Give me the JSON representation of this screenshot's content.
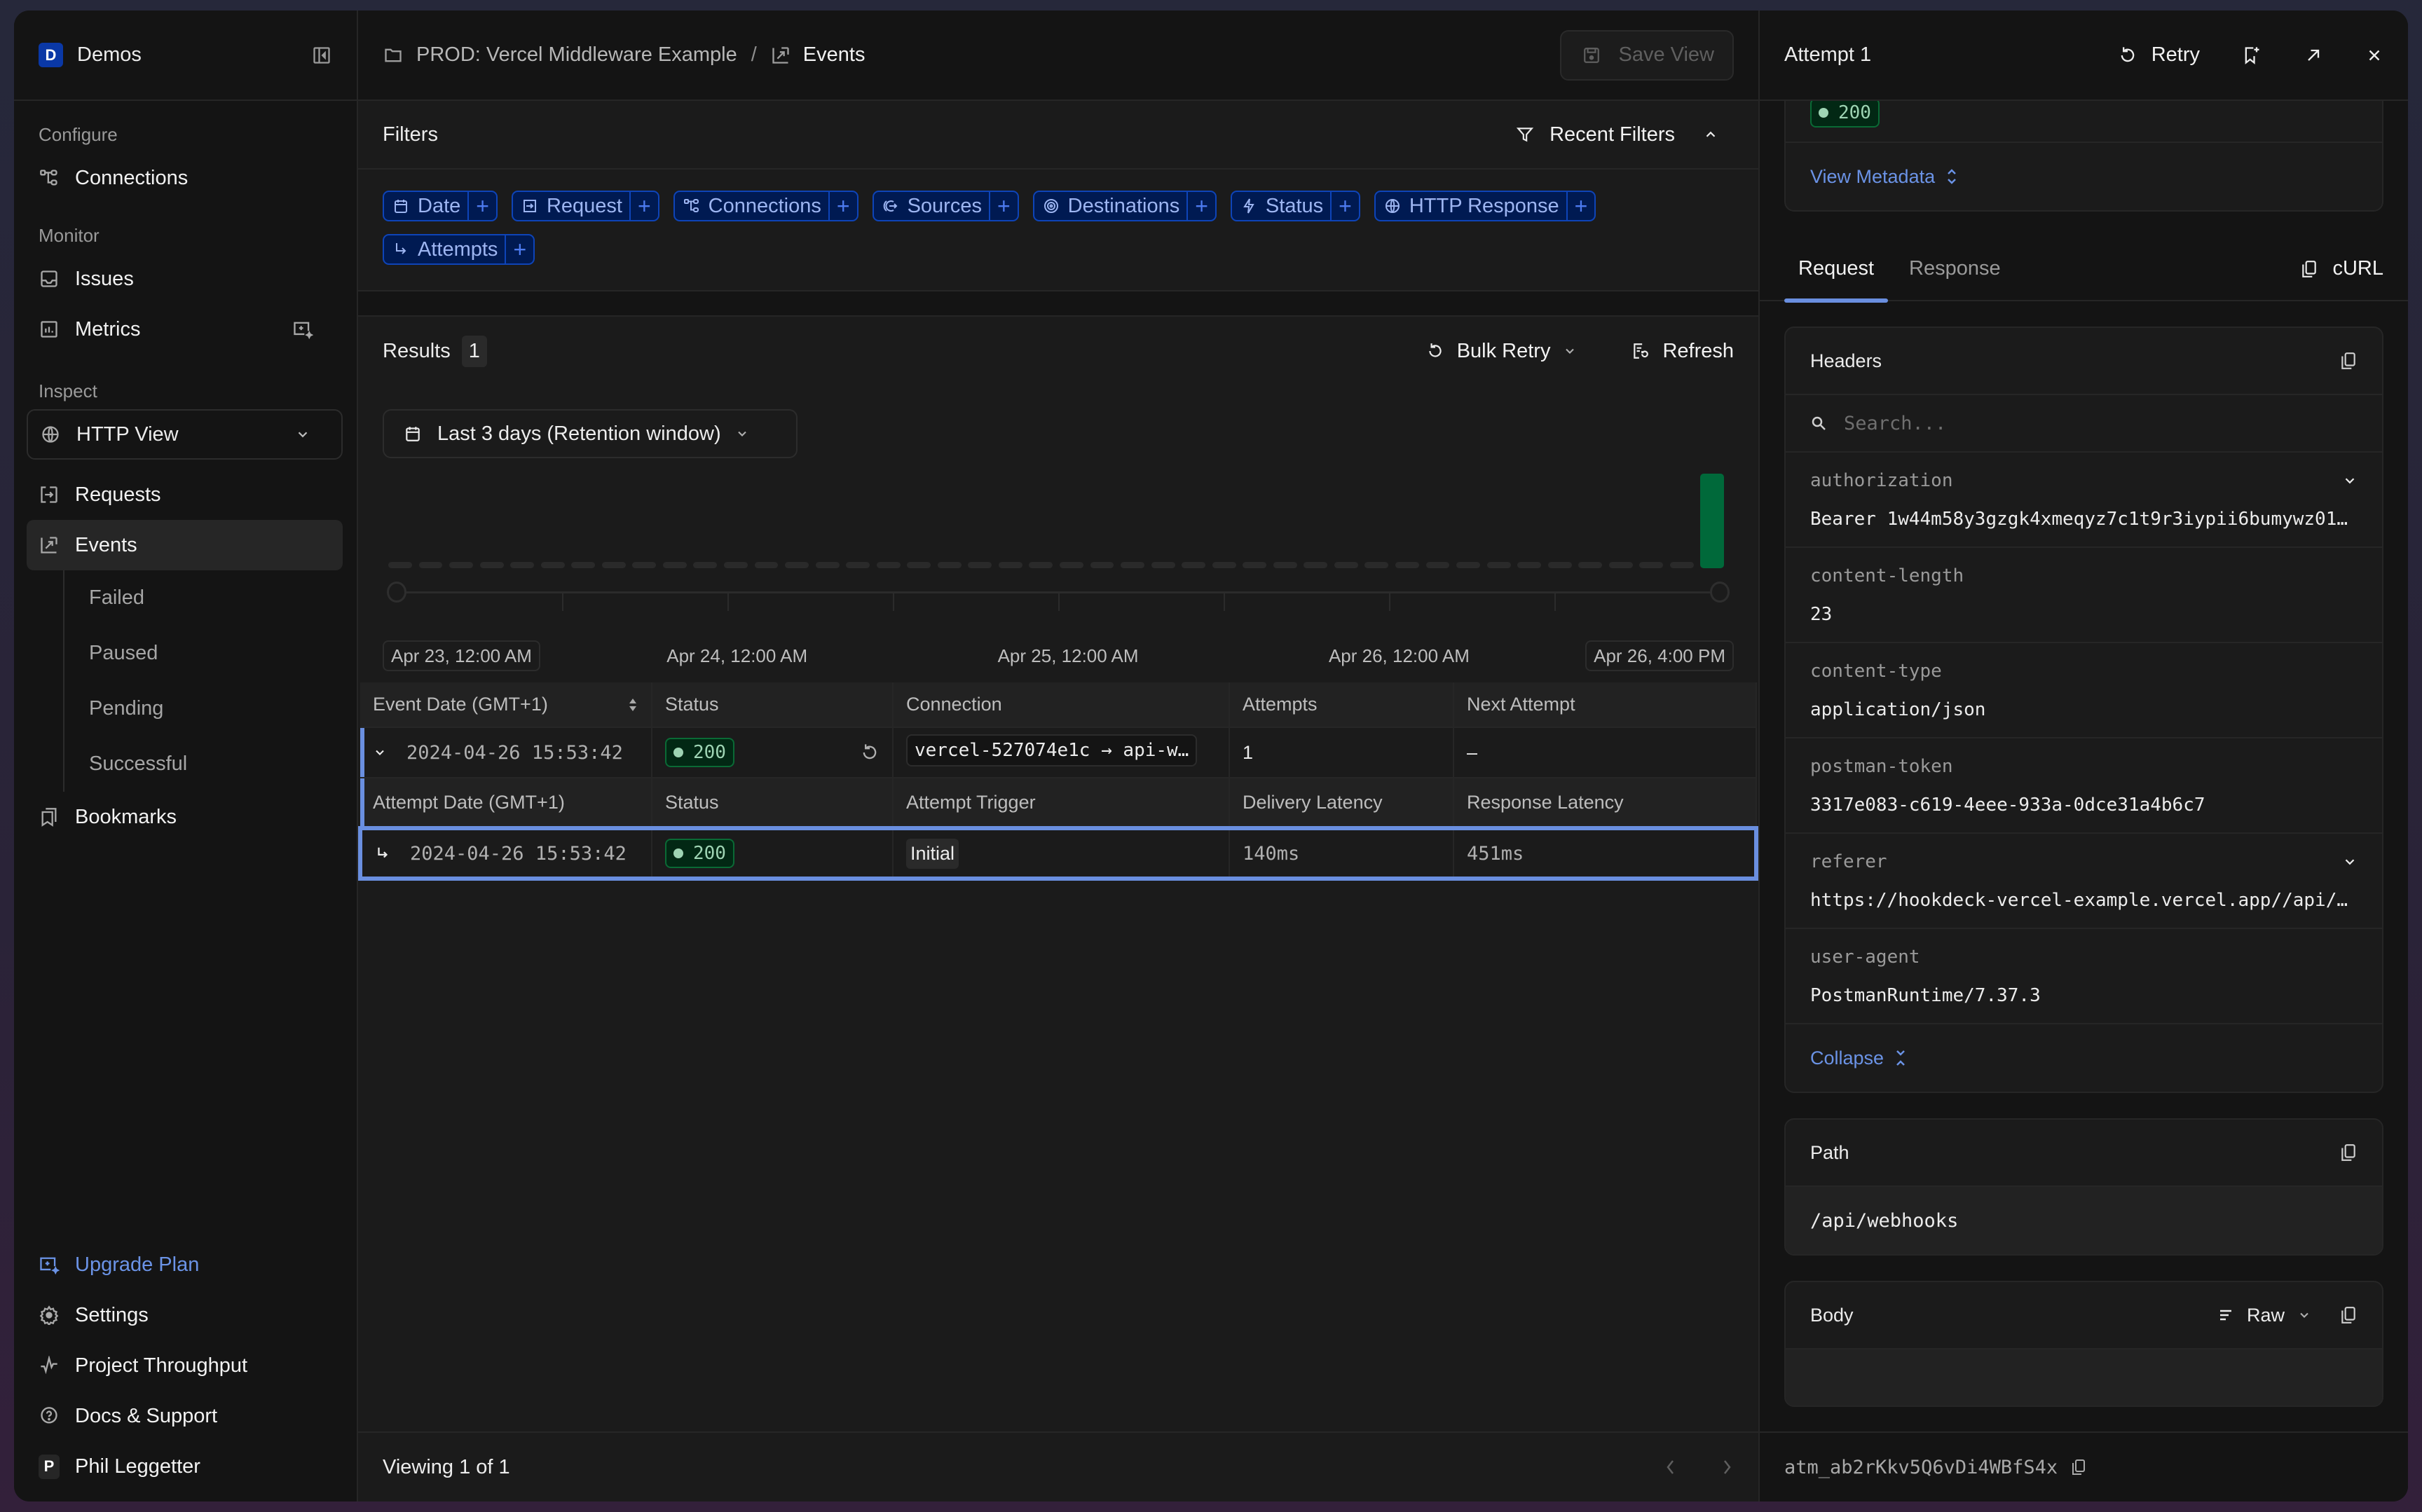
{
  "sidebar": {
    "workspace": {
      "initial": "D",
      "name": "Demos"
    },
    "sections": {
      "configure": "Configure",
      "monitor": "Monitor",
      "inspect": "Inspect"
    },
    "items": {
      "connections": "Connections",
      "issues": "Issues",
      "metrics": "Metrics",
      "view_select": "HTTP View",
      "requests": "Requests",
      "events": "Events",
      "bookmarks": "Bookmarks"
    },
    "event_subitems": [
      "Failed",
      "Paused",
      "Pending",
      "Successful"
    ],
    "bottom": {
      "upgrade": "Upgrade Plan",
      "settings": "Settings",
      "throughput": "Project Throughput",
      "docs": "Docs & Support",
      "user_initial": "P",
      "user_name": "Phil Leggetter"
    }
  },
  "topbar": {
    "project": "PROD: Vercel Middleware Example",
    "separator": "/",
    "page": "Events",
    "save_view": "Save View"
  },
  "filters": {
    "title": "Filters",
    "recent": "Recent Filters",
    "chips": [
      {
        "label": "Date",
        "icon": "calendar-icon"
      },
      {
        "label": "Request",
        "icon": "request-icon"
      },
      {
        "label": "Connections",
        "icon": "connections-icon"
      },
      {
        "label": "Sources",
        "icon": "sources-icon"
      },
      {
        "label": "Destinations",
        "icon": "destinations-icon"
      },
      {
        "label": "Status",
        "icon": "bolt-icon"
      },
      {
        "label": "HTTP Response",
        "icon": "globe-icon"
      },
      {
        "label": "Attempts",
        "icon": "attempts-arrow-icon"
      }
    ],
    "add_symbol": "+"
  },
  "results": {
    "title": "Results",
    "count": "1",
    "bulk_retry": "Bulk Retry",
    "refresh": "Refresh",
    "date_range": "Last 3 days (Retention window)"
  },
  "chart_data": {
    "type": "bar",
    "title": "",
    "xlabel": "",
    "ylabel": "",
    "bucket_count": 44,
    "values": [
      0,
      0,
      0,
      0,
      0,
      0,
      0,
      0,
      0,
      0,
      0,
      0,
      0,
      0,
      0,
      0,
      0,
      0,
      0,
      0,
      0,
      0,
      0,
      0,
      0,
      0,
      0,
      0,
      0,
      0,
      0,
      0,
      0,
      0,
      0,
      0,
      0,
      0,
      0,
      0,
      0,
      0,
      0,
      1
    ],
    "x_tick_labels": [
      "Apr 23, 12:00 AM",
      "Apr 24, 12:00 AM",
      "Apr 25, 12:00 AM",
      "Apr 26, 12:00 AM",
      "Apr 26, 4:00 PM"
    ],
    "x_range": [
      "Apr 23, 12:00 AM",
      "Apr 26, 4:00 PM"
    ],
    "ylim": [
      0,
      1
    ],
    "colors": {
      "success": "#00693a",
      "empty": "#2a2a2a"
    },
    "grid": false,
    "legend": "none"
  },
  "table": {
    "event_columns": [
      "Event Date (GMT+1)",
      "Status",
      "Connection",
      "Attempts",
      "Next Attempt"
    ],
    "event_row": {
      "date": "2024-04-26 15:53:42",
      "status": "200",
      "connection": "vercel-527074e1c → api-w…",
      "attempts": "1",
      "next_attempt": "–"
    },
    "attempt_columns": [
      "Attempt Date (GMT+1)",
      "Status",
      "Attempt Trigger",
      "Delivery Latency",
      "Response Latency"
    ],
    "attempt_row": {
      "date": "2024-04-26 15:53:42",
      "status": "200",
      "trigger": "Initial",
      "delivery_latency": "140ms",
      "response_latency": "451ms"
    }
  },
  "footer": {
    "viewing": "Viewing 1 of 1"
  },
  "panel": {
    "title": "Attempt 1",
    "retry": "Retry",
    "status": "200",
    "view_metadata": "View Metadata",
    "tabs": [
      "Request",
      "Response"
    ],
    "active_tab": "Request",
    "curl": "cURL",
    "headers_title": "Headers",
    "search_placeholder": "Search...",
    "headers": [
      {
        "key": "authorization",
        "value": "Bearer 1w44m58y3gzgk4xmeqyz7c1t9r3iypii6bumywz01…",
        "expandable": true
      },
      {
        "key": "content-length",
        "value": "23",
        "expandable": false
      },
      {
        "key": "content-type",
        "value": "application/json",
        "expandable": false
      },
      {
        "key": "postman-token",
        "value": "3317e083-c619-4eee-933a-0dce31a4b6c7",
        "expandable": false
      },
      {
        "key": "referer",
        "value": "https://hookdeck-vercel-example.vercel.app//api/…",
        "expandable": true
      },
      {
        "key": "user-agent",
        "value": "PostmanRuntime/7.37.3",
        "expandable": false
      }
    ],
    "collapse": "Collapse",
    "path_title": "Path",
    "path_value": "/api/webhooks",
    "body_title": "Body",
    "body_format": "Raw",
    "attempt_id": "atm_ab2rKkv5Q6vDi4WBfS4x"
  },
  "colors": {
    "accent": "#6a8fe0",
    "chip_bg": "#001a52",
    "chip_border": "#0e44b8",
    "success": "#0a6a35",
    "workspace_badge": "#0a38a6"
  }
}
